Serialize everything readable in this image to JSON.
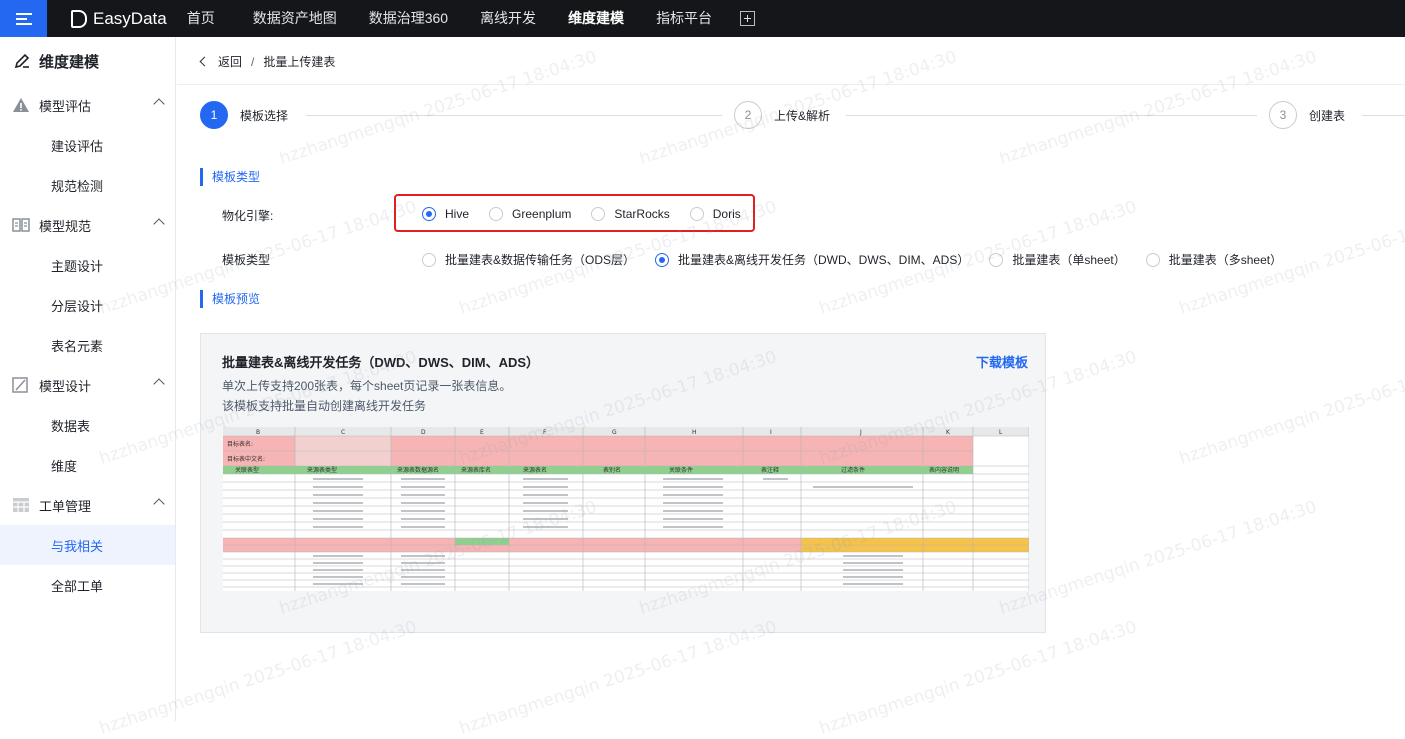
{
  "topbar": {
    "logo_text": "EasyData",
    "nav": [
      "首页",
      "数据资产地图",
      "数据治理360",
      "离线开发",
      "维度建模",
      "指标平台"
    ],
    "active_nav_index": 4,
    "accent_color": "#2468f2"
  },
  "sidebar": {
    "title": "维度建模",
    "groups": [
      {
        "label": "模型评估",
        "icon": "warning-triangle-icon",
        "items": [
          "建设评估",
          "规范检测"
        ]
      },
      {
        "label": "模型规范",
        "icon": "book-icon",
        "items": [
          "主题设计",
          "分层设计",
          "表名元素"
        ]
      },
      {
        "label": "模型设计",
        "icon": "design-icon",
        "items": [
          "数据表",
          "维度"
        ]
      },
      {
        "label": "工单管理",
        "icon": "calendar-grid-icon",
        "items": [
          "与我相关",
          "全部工单"
        ]
      }
    ],
    "active_item": "与我相关"
  },
  "breadcrumb": {
    "back": "返回",
    "separator": "/",
    "current": "批量上传建表"
  },
  "steps": [
    {
      "num": "1",
      "label": "模板选择",
      "active": true
    },
    {
      "num": "2",
      "label": "上传&解析",
      "active": false
    },
    {
      "num": "3",
      "label": "创建表",
      "active": false
    }
  ],
  "section_template_type": "模板类型",
  "engine": {
    "label": "物化引擎:",
    "options": [
      "Hive",
      "Greenplum",
      "StarRocks",
      "Doris"
    ],
    "selected": "Hive"
  },
  "template_type": {
    "label": "模板类型",
    "options": [
      "批量建表&数据传输任务（ODS层）",
      "批量建表&离线开发任务（DWD、DWS、DIM、ADS）",
      "批量建表（单sheet）",
      "批量建表（多sheet）"
    ],
    "selected": "批量建表&离线开发任务（DWD、DWS、DIM、ADS）"
  },
  "section_preview": "模板预览",
  "preview": {
    "title": "批量建表&离线开发任务（DWD、DWS、DIM、ADS）",
    "download": "下载模板",
    "desc1": "单次上传支持200张表，每个sheet页记录一张表信息。",
    "desc2": "该模板支持批量自动创建离线开发任务",
    "sheet_columns": [
      "B",
      "C",
      "D",
      "E",
      "F",
      "G",
      "H",
      "I",
      "J",
      "K",
      "L"
    ],
    "sheet_row_labels": [
      "目标表名:",
      "目标表中文名:",
      "关联表型",
      "来源表类型",
      "来源表数据源名",
      "来源表库名",
      "来源表名",
      "表别名",
      "关联条件",
      "表注释",
      "过滤条件",
      "表内容说明"
    ]
  },
  "watermark": "hzzhangmengqin 2025-06-17 18:04:30"
}
